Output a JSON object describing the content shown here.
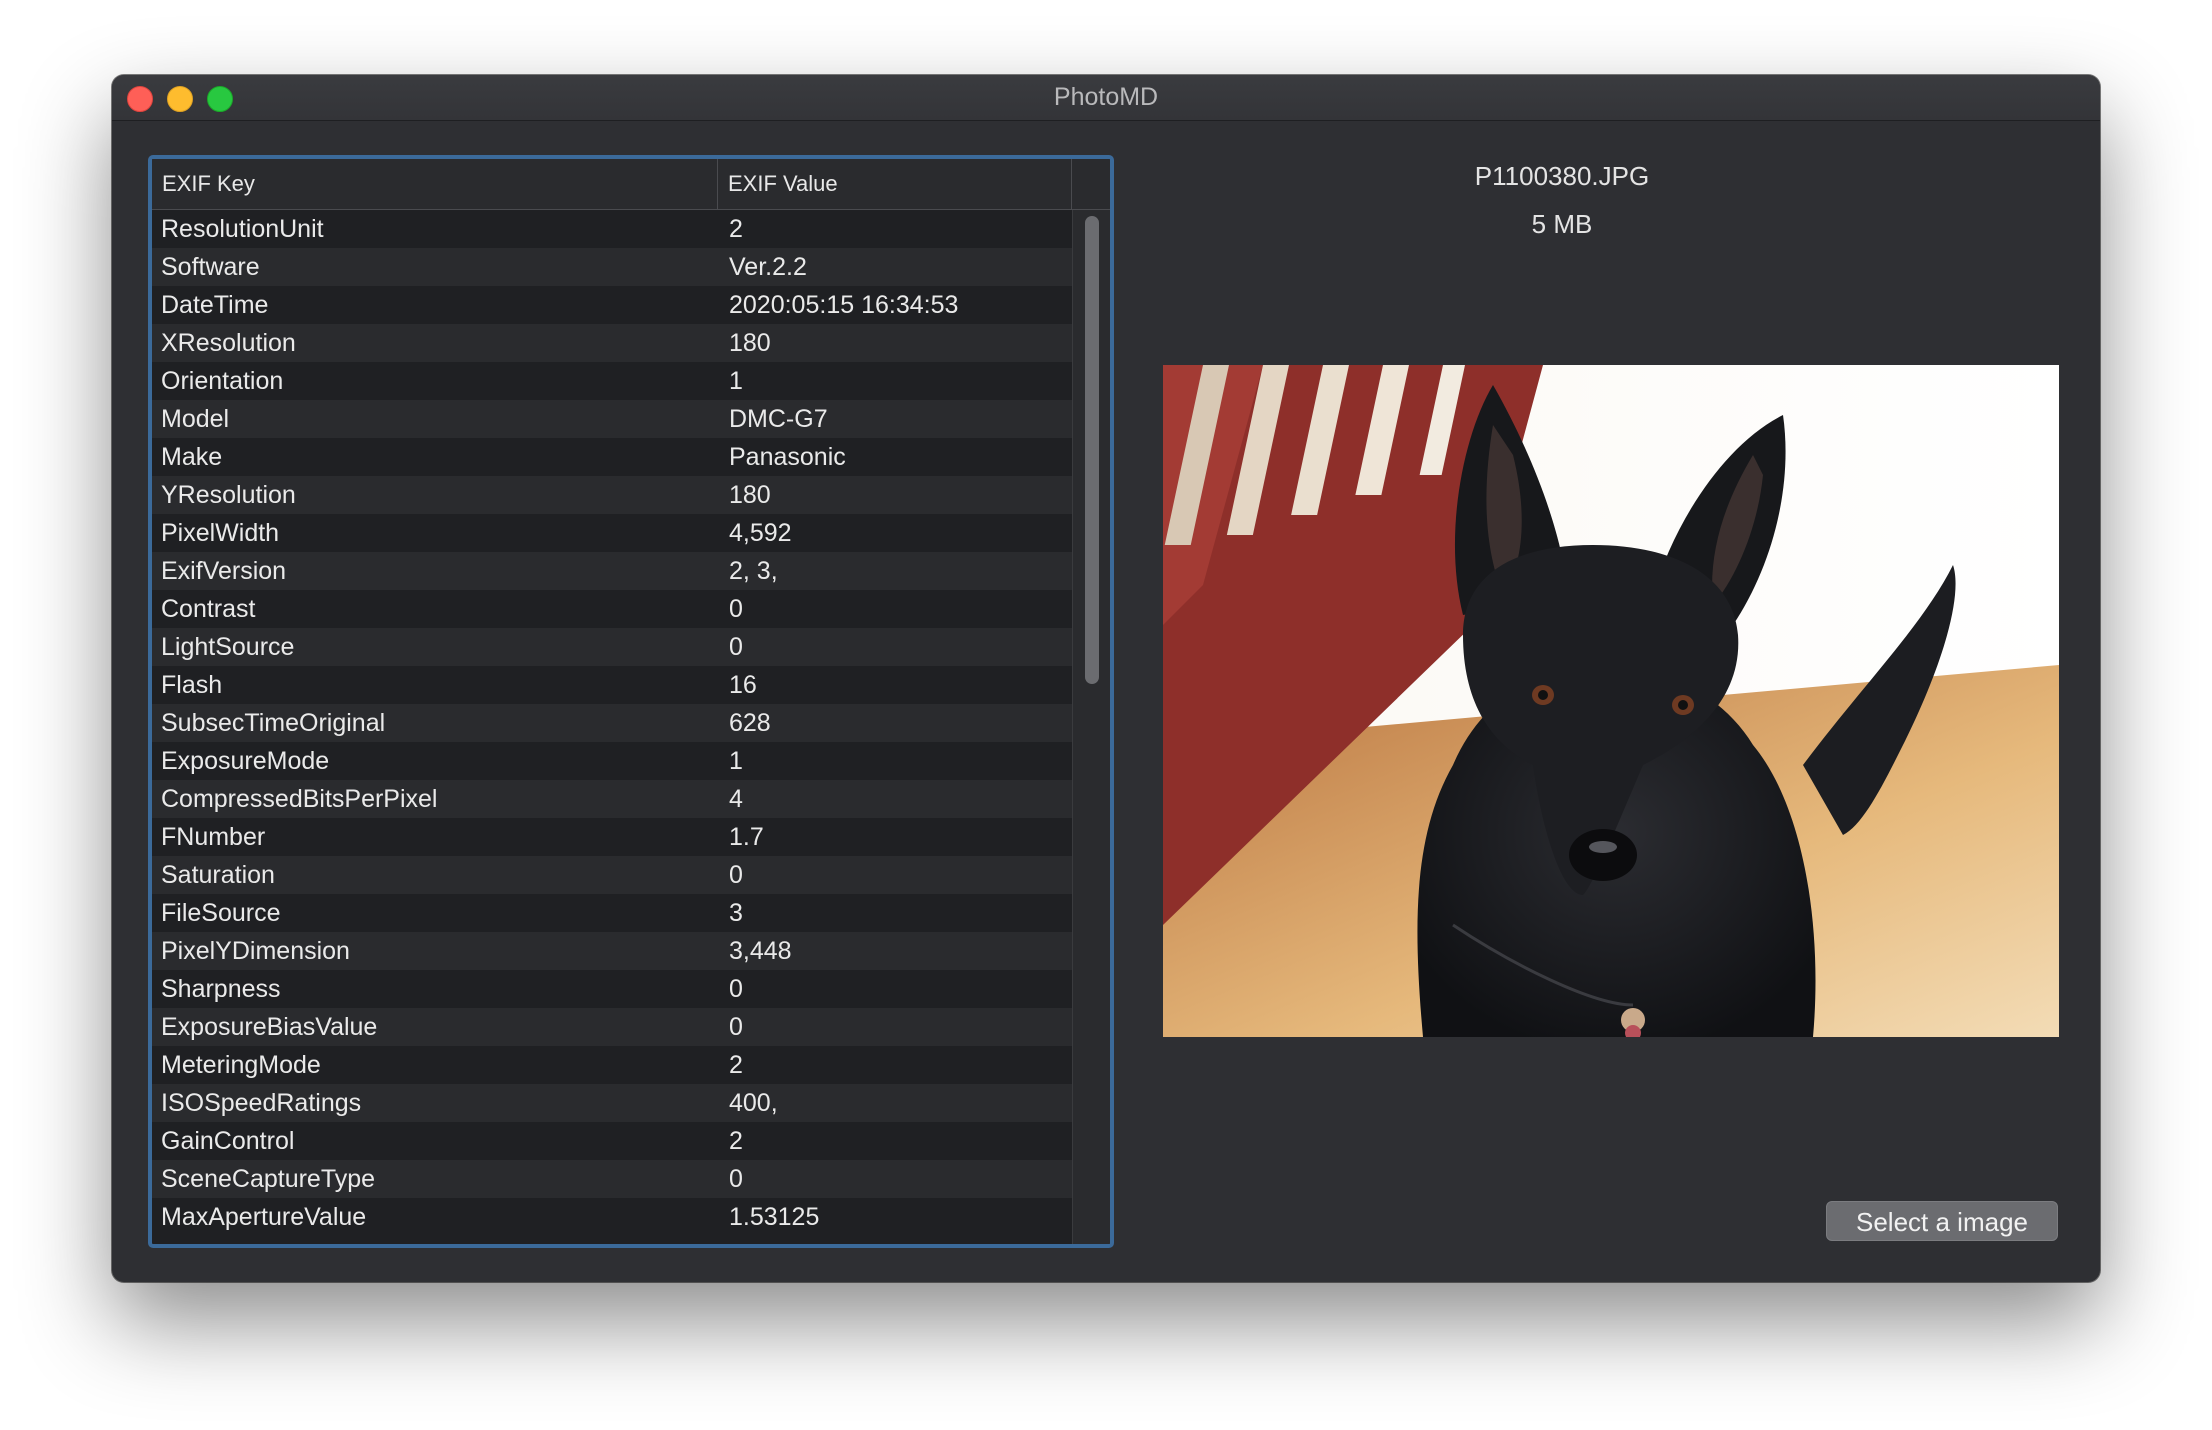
{
  "window": {
    "title": "PhotoMD"
  },
  "table": {
    "columns": [
      "EXIF Key",
      "EXIF Value"
    ],
    "rows": [
      [
        "ResolutionUnit",
        "2"
      ],
      [
        "Software",
        "Ver.2.2"
      ],
      [
        "DateTime",
        "2020:05:15 16:34:53"
      ],
      [
        "XResolution",
        "180"
      ],
      [
        "Orientation",
        "1"
      ],
      [
        "Model",
        "DMC-G7"
      ],
      [
        "Make",
        "Panasonic"
      ],
      [
        "YResolution",
        "180"
      ],
      [
        "PixelWidth",
        "4,592"
      ],
      [
        "ExifVersion",
        "2, 3,"
      ],
      [
        "Contrast",
        "0"
      ],
      [
        "LightSource",
        "0"
      ],
      [
        "Flash",
        "16"
      ],
      [
        "SubsecTimeOriginal",
        "628"
      ],
      [
        "ExposureMode",
        "1"
      ],
      [
        "CompressedBitsPerPixel",
        "4"
      ],
      [
        "FNumber",
        "1.7"
      ],
      [
        "Saturation",
        "0"
      ],
      [
        "FileSource",
        "3"
      ],
      [
        "PixelYDimension",
        "3,448"
      ],
      [
        "Sharpness",
        "0"
      ],
      [
        "ExposureBiasValue",
        "0"
      ],
      [
        "MeteringMode",
        "2"
      ],
      [
        "ISOSpeedRatings",
        "400,"
      ],
      [
        "GainControl",
        "2"
      ],
      [
        "SceneCaptureType",
        "0"
      ],
      [
        "MaxApertureValue",
        "1.53125"
      ]
    ]
  },
  "file": {
    "name": "P1100380.JPG",
    "size": "5 MB"
  },
  "buttons": {
    "select_image": "Select a image"
  },
  "colors": {
    "selection_border": "#3b6a9a",
    "window_bg": "#2e2f33"
  }
}
